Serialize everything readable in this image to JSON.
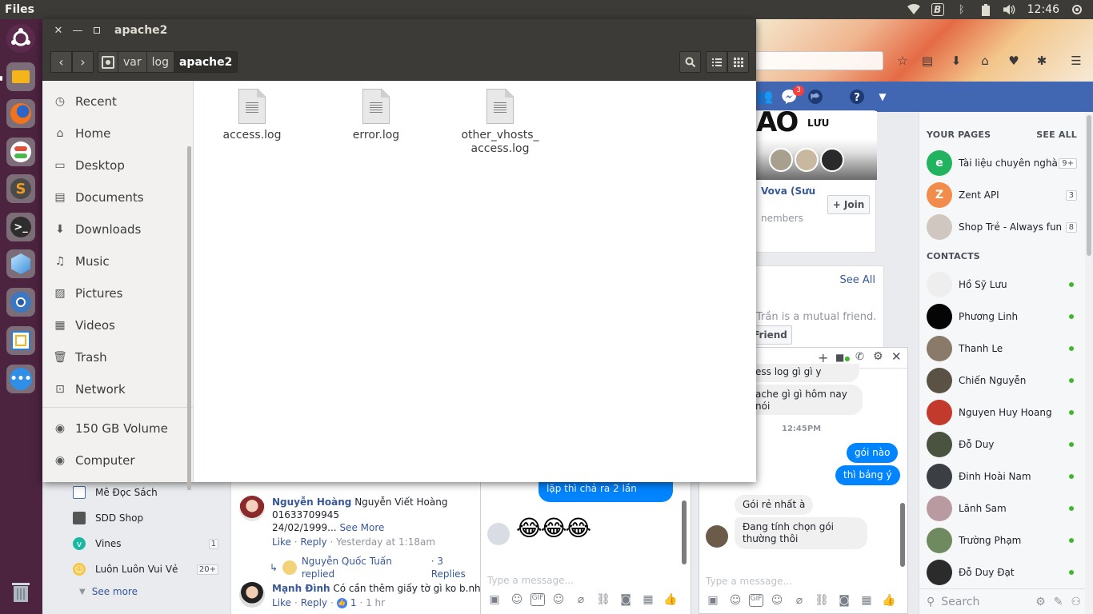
{
  "topbar": {
    "app_name": "Files",
    "time": "12:46",
    "tray_icons": [
      "wifi-icon",
      "bluetooth-b-icon",
      "bluetooth-icon",
      "battery-icon",
      "volume-icon"
    ]
  },
  "launcher": {
    "items": [
      "ubuntu-logo-icon",
      "files-icon",
      "firefox-icon",
      "settings-toggle-icon",
      "sublime-icon",
      "terminal-icon",
      "box-app-icon",
      "chromium-icon",
      "screenshot-icon",
      "more-apps-icon",
      "trash-icon"
    ]
  },
  "files_window": {
    "title": "apache2",
    "breadcrumb": [
      "var",
      "log",
      "apache2"
    ],
    "sidebar": [
      {
        "label": "Recent",
        "icon": "recent-icon"
      },
      {
        "label": "Home",
        "icon": "home-icon"
      },
      {
        "label": "Desktop",
        "icon": "desktop-icon"
      },
      {
        "label": "Documents",
        "icon": "documents-icon"
      },
      {
        "label": "Downloads",
        "icon": "downloads-icon"
      },
      {
        "label": "Music",
        "icon": "music-icon"
      },
      {
        "label": "Pictures",
        "icon": "pictures-icon"
      },
      {
        "label": "Videos",
        "icon": "videos-icon"
      },
      {
        "label": "Trash",
        "icon": "trash-icon"
      },
      {
        "label": "Network",
        "icon": "network-icon"
      },
      {
        "label": "150 GB Volume",
        "icon": "drive-icon"
      },
      {
        "label": "Computer",
        "icon": "computer-icon"
      }
    ],
    "files": [
      {
        "name": "access.log"
      },
      {
        "name": "error.log"
      },
      {
        "name": "other_vhosts_ access.log"
      }
    ]
  },
  "facebook": {
    "messenger_badge": "3",
    "group_card": {
      "title_text": "AO",
      "subtitle_text": "LƯU",
      "name": "Vova (Sưu",
      "members": "nembers",
      "join_label": "+ Join"
    },
    "suggest_card": {
      "see_all": "See All",
      "mutual": "Trần is a mutual friend.",
      "friend_btn": "Friend"
    },
    "your_pages": {
      "heading": "YOUR PAGES",
      "see_all": "SEE ALL",
      "items": [
        {
          "name": "Tài liệu chuyên nghà...",
          "count": "9+",
          "avatar": "e",
          "color": "#21b35f"
        },
        {
          "name": "Zent API",
          "count": "3",
          "avatar": "Z",
          "color": "#f28c4a"
        },
        {
          "name": "Shop Trẻ - Always fun",
          "count": "8",
          "avatar": "",
          "color": "#d0c8c0"
        }
      ]
    },
    "contacts": {
      "heading": "CONTACTS",
      "items": [
        {
          "name": "Hồ Sỹ Lưu",
          "color": "#eeeeee"
        },
        {
          "name": "Phương Linh",
          "color": "#050505"
        },
        {
          "name": "Thanh Le",
          "color": "#8a7a6a"
        },
        {
          "name": "Chiến Nguyễn",
          "color": "#5b5246"
        },
        {
          "name": "Nguyen Huy Hoang",
          "color": "#c23a2c"
        },
        {
          "name": "Đỗ Duy",
          "color": "#4a5240"
        },
        {
          "name": "Đinh Hoài Nam",
          "color": "#3b3f44"
        },
        {
          "name": "Lãnh Sam",
          "color": "#b99aa0"
        },
        {
          "name": "Trường Phạm",
          "color": "#6f8a5e"
        },
        {
          "name": "Đỗ Duy Đạt",
          "color": "#2b2b2b"
        }
      ]
    },
    "search_placeholder": "Search",
    "left_menu": [
      {
        "label": "Mê Đọc Sách",
        "badge": ""
      },
      {
        "label": "SDD Shop",
        "badge": ""
      },
      {
        "label": "Vines",
        "badge": "1"
      },
      {
        "label": "Luôn Luôn Vui Vẻ",
        "badge": "20+"
      }
    ],
    "see_more": "See more",
    "comment1": {
      "name": "Nguyễn Hoàng",
      "text": "Nguyễn Viết Hoàng",
      "line2": "01633709945",
      "line3": "24/02/1999...",
      "see_more": "See More",
      "like": "Like",
      "reply": "Reply",
      "time": "Yesterday at 1:18am",
      "replier": "Nguyễn Quốc Tuấn replied",
      "replies": "· 3 Replies"
    },
    "comment2": {
      "name": "Mạnh Đình",
      "text": "Có cần thêm giấy tờ gì ko b.như giấy",
      "like": "Like",
      "reply": "Reply",
      "reactions": "1",
      "time": "· 1 hr"
    },
    "chat1": {
      "message": "lặp thì chả ra 2 lần",
      "emoji": "😂😂😂",
      "placeholder": "Type a message..."
    },
    "chat2": {
      "msg1": "ess log gì gì y",
      "msg2": "ache gì gì hôm nay nói",
      "time": "12:45PM",
      "out1": "gói nào",
      "out2": "thì bảng ý",
      "in1": "Gói rẻ nhất à",
      "in2": "Đang tính chọn gói thường thôi",
      "placeholder": "Type a message..."
    }
  }
}
